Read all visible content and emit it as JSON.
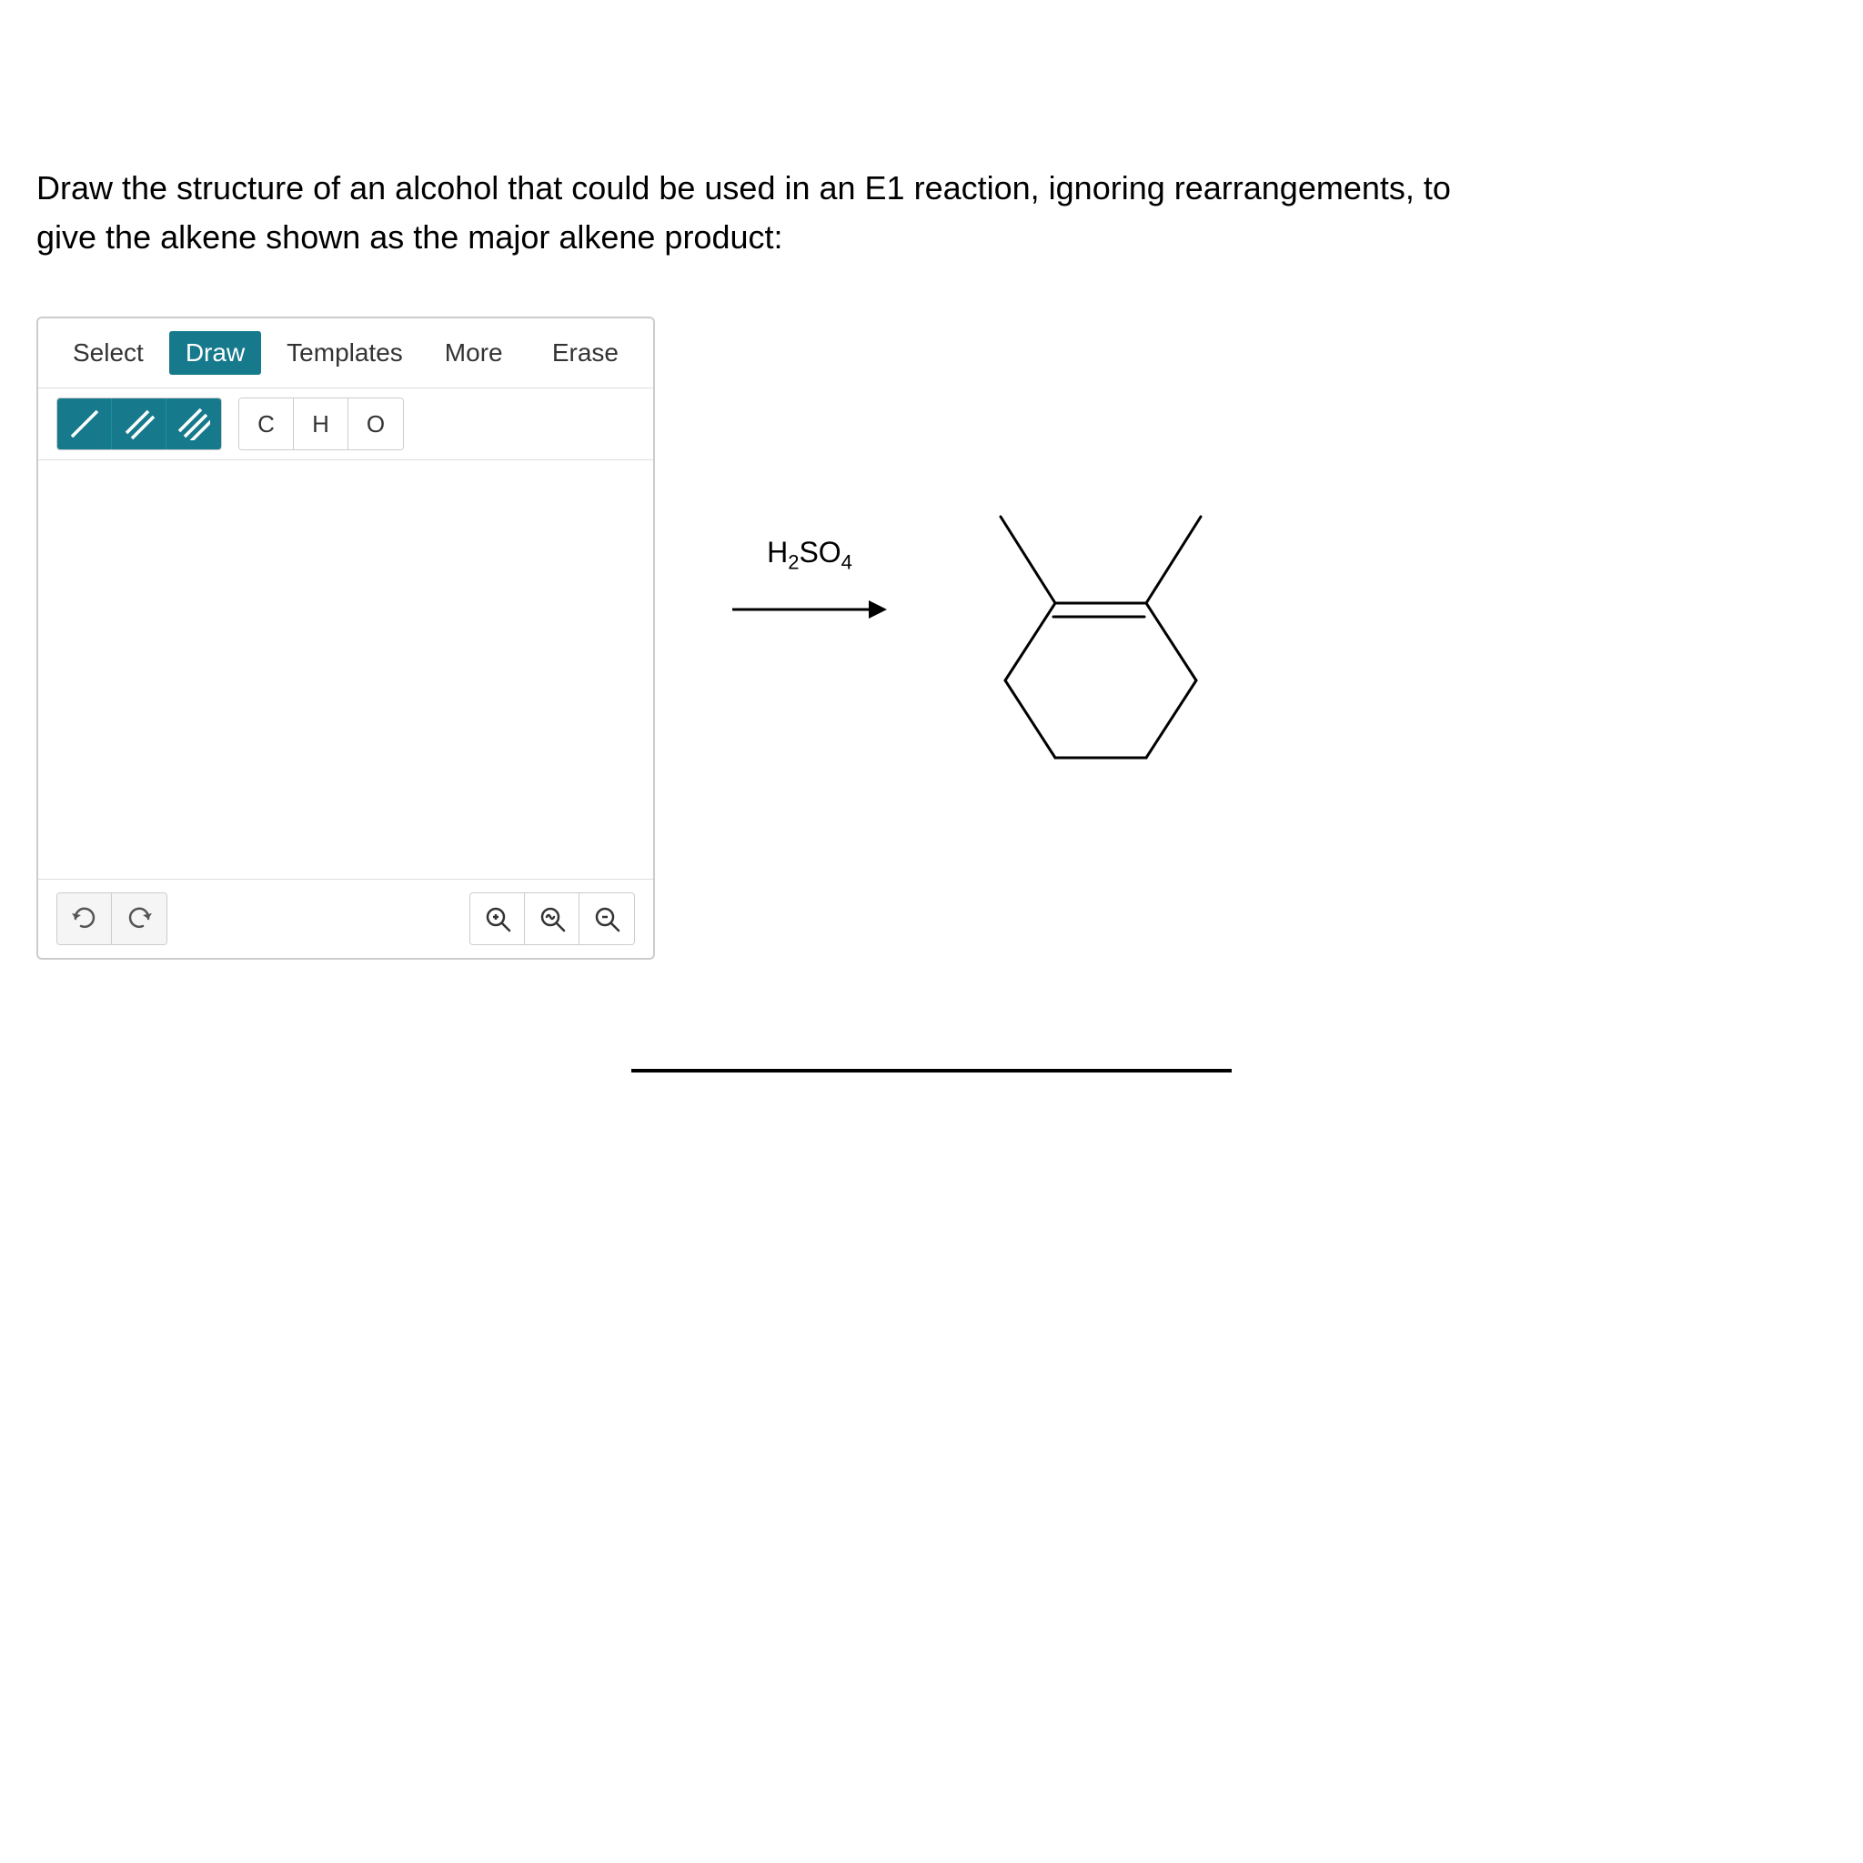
{
  "question": {
    "text": "Draw the structure of an alcohol that could be used in an E1 reaction, ignoring rearrangements, to give the alkene shown as the major alkene product:"
  },
  "toolbar": {
    "select_label": "Select",
    "draw_label": "Draw",
    "templates_label": "Templates",
    "more_label": "More",
    "erase_label": "Erase",
    "active_tab": "Draw"
  },
  "bonds": {
    "single_label": "single bond",
    "double_label": "double bond",
    "triple_label": "triple bond"
  },
  "atoms": {
    "carbon_label": "C",
    "hydrogen_label": "H",
    "oxygen_label": "O"
  },
  "history": {
    "undo_label": "undo",
    "redo_label": "redo"
  },
  "zoom": {
    "zoom_in_label": "zoom in",
    "reset_label": "reset zoom",
    "zoom_out_label": "zoom out"
  },
  "reaction": {
    "catalyst": "H₂SO₄",
    "arrow_label": "reaction arrow"
  },
  "colors": {
    "teal": "#177a8c",
    "border": "#cccccc",
    "text": "#333333"
  }
}
